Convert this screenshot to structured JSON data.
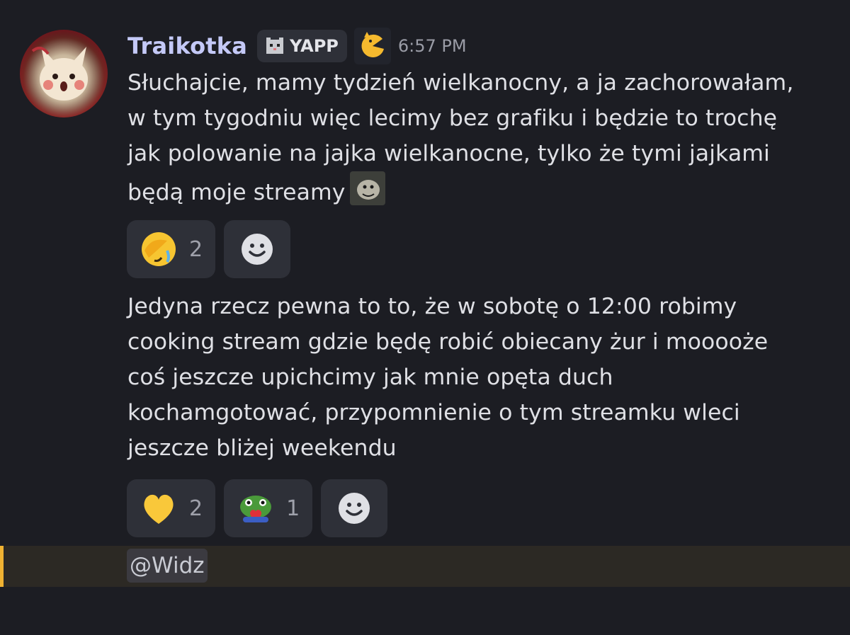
{
  "author": {
    "username": "Traikotka",
    "avatar_icon": "pikachu-avatar-icon",
    "tag": {
      "icon": "pixel-cat-icon",
      "label": "YAPP"
    },
    "role_icon": "pacman-cat-icon",
    "timestamp": "6:57 PM"
  },
  "messages": [
    {
      "text": "Słuchajcie, mamy tydzień wielkanocny, a ja zachorowałam,\nw tym tygodniu więc lecimy bez grafiku i będzie to trochę\njak polowanie na jajka wielkanocne, tylko że tymi jajkami\nbędą moje streamy",
      "inline_emoji": "custom-creature-emoji",
      "reactions": [
        {
          "emoji": "face-palm-crying-emoji",
          "count": "2"
        }
      ]
    },
    {
      "text": "Jedyna rzecz pewna to to, że w sobotę o 12:00 robimy\ncooking stream gdzie będę robić obiecany żur i mooooże\ncoś jeszcze upichcimy jak mnie opęta duch\nkochamgotować, przypomnienie o tym streamku wleci\njeszcze bliżej weekendu",
      "reactions": [
        {
          "emoji": "yellow-heart-emoji",
          "count": "2"
        },
        {
          "emoji": "frog-heart-emoji",
          "count": "1"
        }
      ]
    }
  ],
  "add_reaction_icon": "smiley-add-reaction-icon",
  "mention": {
    "text": "@Widz"
  },
  "colors": {
    "background": "#1c1d23",
    "username": "#c4c9f7",
    "mention_highlight": "#2c2924",
    "mention_accent": "#f0b232"
  }
}
